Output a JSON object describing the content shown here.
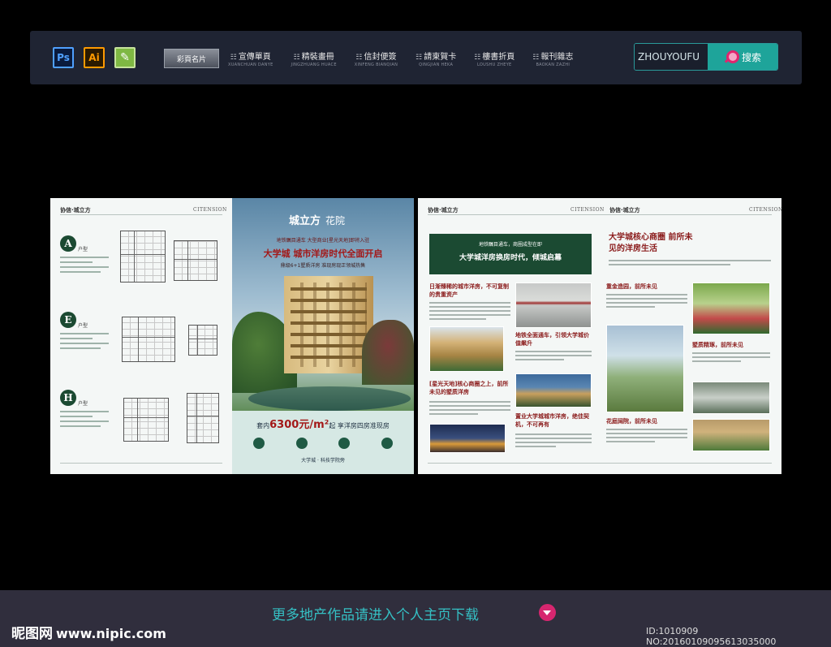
{
  "toolbar": {
    "app_icons": [
      {
        "label": "Ps",
        "icon": "photoshop-icon"
      },
      {
        "label": "Ai",
        "icon": "illustrator-icon"
      },
      {
        "label": "",
        "icon": "coreldraw-icon"
      }
    ],
    "nav": [
      {
        "label": "彩頁名片",
        "active": true
      },
      {
        "label": "宣傳單頁",
        "sub": "XUANCHUAN DANYE"
      },
      {
        "label": "精裝畫冊",
        "sub": "JINGZHUANG HUACE"
      },
      {
        "label": "信封便簽",
        "sub": "XINFENG BIANQIAN"
      },
      {
        "label": "請柬賀卡",
        "sub": "QINGJIAN HEKA"
      },
      {
        "label": "樓書折頁",
        "sub": "LOUSHU ZHEYE"
      },
      {
        "label": "報刊雜志",
        "sub": "BAOKAN ZAZHI"
      }
    ],
    "search": {
      "value": "ZHOUYOUFU",
      "button": "搜索"
    }
  },
  "brochure_left": {
    "brand": "协信·城立方",
    "brand_en": "CITENSION",
    "types": [
      {
        "badge": "A",
        "label": "户型"
      },
      {
        "badge": "E",
        "label": "户型"
      },
      {
        "badge": "H",
        "label": "户型"
      }
    ],
    "cover": {
      "logo": "城立方",
      "logo_suffix": "花院",
      "subline": "地铁瞩目通车 大型商业[星光天地]即将入驻",
      "headline": "大学城 城市洋房时代全面开启",
      "subline2": "鼎级6+1墅质洋房 准现房现正领城热售",
      "price_prefix": "套内",
      "price": "6300元/m²",
      "price_suffix": "起 享洋房四房准现房",
      "footer": "大学城 · 科技学院旁"
    }
  },
  "brochure_right": {
    "brand": "协信·城立方",
    "brand_en": "CITENSION",
    "banner_line1": "地铁瞩目通车，商圈成型在即",
    "banner_line2": "大学城洋房换房时代，倾城启幕",
    "heads": [
      "日渐臻稀的城市洋房，不可复制的贵重资产",
      "地铁全面通车，引领大学城价值飙升",
      "[星光天地]核心商圈之上，前所未见的墅质洋房",
      "置业大学城城市洋房，绝佳契机，不可再有"
    ],
    "right_title": "大学城核心商圈 前所未见的洋房生活",
    "right_heads": [
      "重金造园，前所未见",
      "墅质精琢，前所未见",
      "花庭阔院，前所未见"
    ]
  },
  "footer": {
    "promo": "更多地产作品请进入个人主页下载",
    "logo": "昵图网",
    "logo_url": "www.nipic.com",
    "id_line": "ID:1010909 NO:20160109095613035000"
  }
}
